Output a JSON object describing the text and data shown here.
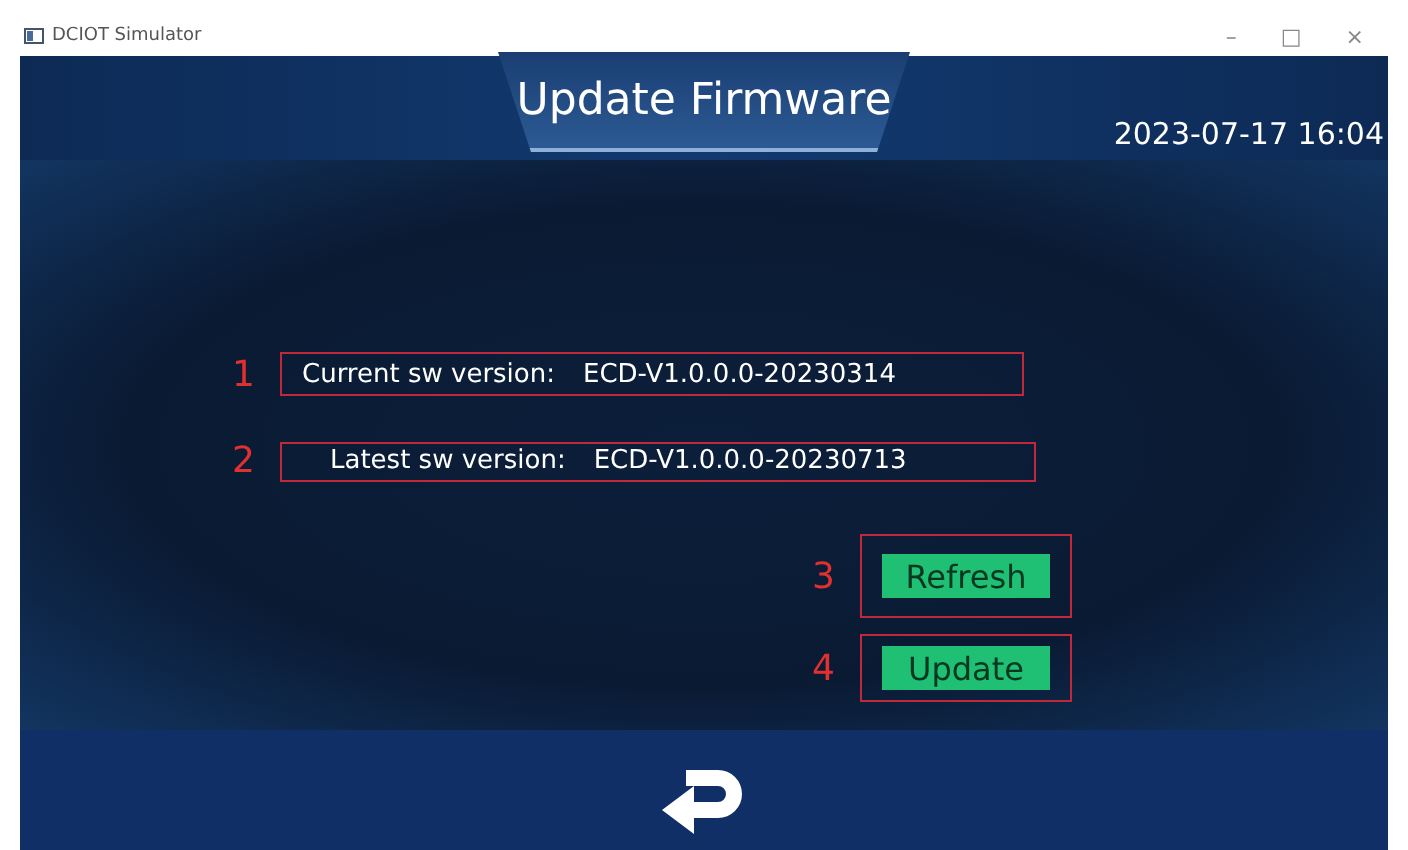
{
  "window": {
    "title": "DCIOT Simulator",
    "controls": [
      "–",
      "□",
      "×"
    ]
  },
  "header": {
    "title": "Update Firmware",
    "datetime": "2023-07-17 16:04"
  },
  "versions": [
    {
      "marker": "1",
      "label": "Current sw version:",
      "value": "ECD-V1.0.0.0-20230314"
    },
    {
      "marker": "2",
      "label": "Latest sw version:",
      "value": "ECD-V1.0.0.0-20230713"
    }
  ],
  "buttons": [
    {
      "marker": "3",
      "label": "Refresh"
    },
    {
      "marker": "4",
      "label": "Update"
    }
  ]
}
